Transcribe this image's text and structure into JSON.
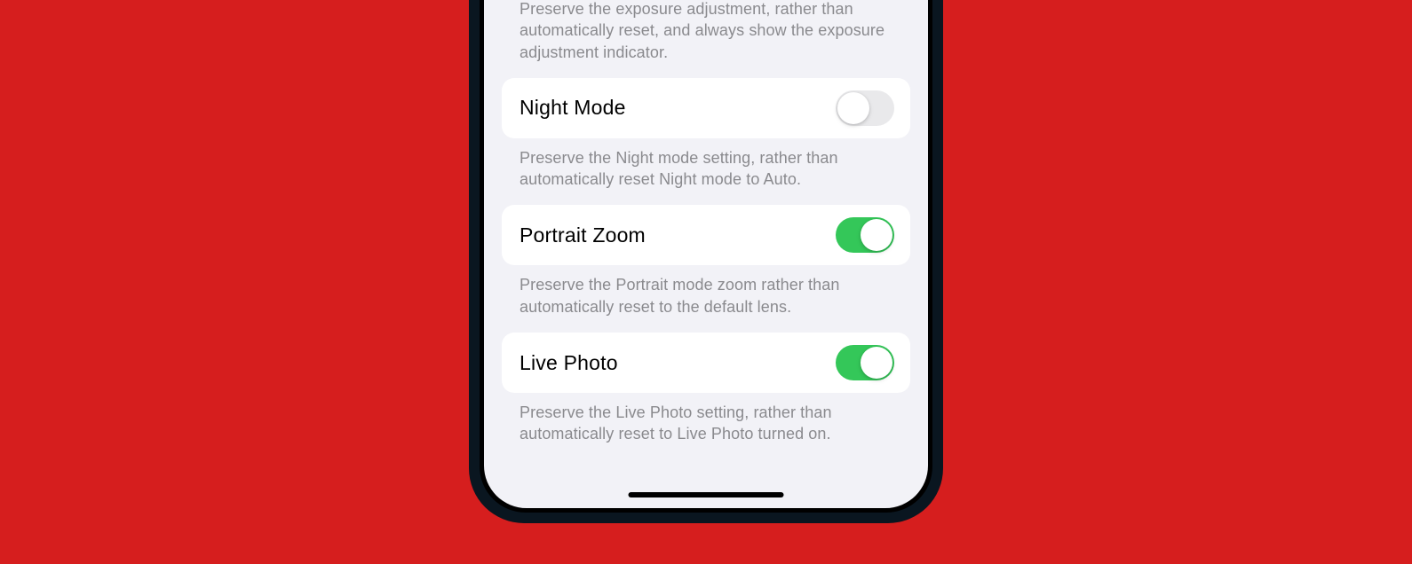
{
  "settings": {
    "exposure": {
      "description": "Preserve the exposure adjustment, rather than automatically reset, and always show the exposure adjustment indicator."
    },
    "nightMode": {
      "label": "Night Mode",
      "enabled": false,
      "description": "Preserve the Night mode setting, rather than automatically reset Night mode to Auto."
    },
    "portraitZoom": {
      "label": "Portrait Zoom",
      "enabled": true,
      "description": "Preserve the Portrait mode zoom rather than automatically reset to the default lens."
    },
    "livePhoto": {
      "label": "Live Photo",
      "enabled": true,
      "description": "Preserve the Live Photo setting, rather than automatically reset to Live Photo turned on."
    }
  }
}
